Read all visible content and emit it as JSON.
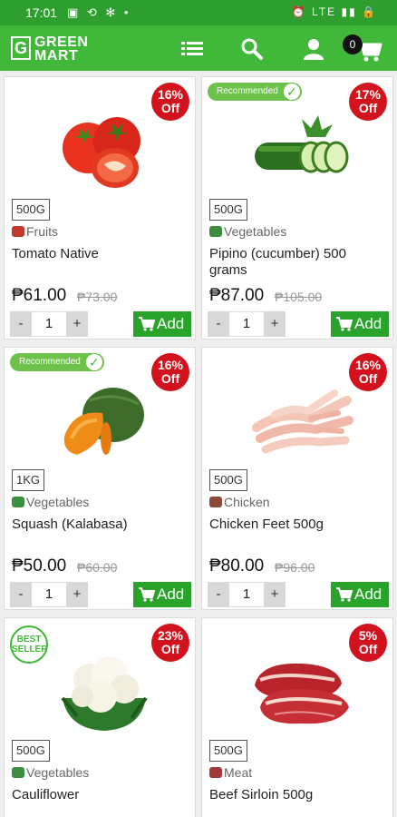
{
  "status_bar": {
    "time": "17:01",
    "left_icons": "▣ ⟲ ✻ •",
    "right_icons": "⏰ LTE ▮▮ 🔒"
  },
  "app": {
    "logo_line1": "GREEN",
    "logo_line2": "MART",
    "logo_letter": "G",
    "cart_count": "0",
    "accent": "#41b839"
  },
  "products": [
    {
      "name": "Tomato Native",
      "weight": "500G",
      "category": "Fruits",
      "cat_color": "#c0392b",
      "price": "₱61.00",
      "old_price": "₱73.00",
      "discount_pct": "16%",
      "discount_label": "Off",
      "qty": "1",
      "add_label": "Add",
      "badge": "",
      "image": "tomato"
    },
    {
      "name": "Pipino (cucumber) 500 grams",
      "weight": "500G",
      "category": "Vegetables",
      "cat_color": "#3e8e41",
      "price": "₱87.00",
      "old_price": "₱105.00",
      "discount_pct": "17%",
      "discount_label": "Off",
      "qty": "1",
      "add_label": "Add",
      "badge": "Recommended",
      "image": "cucumber"
    },
    {
      "name": "Squash (Kalabasa)",
      "weight": "1KG",
      "category": "Vegetables",
      "cat_color": "#3e8e41",
      "price": "₱50.00",
      "old_price": "₱60.00",
      "discount_pct": "16%",
      "discount_label": "Off",
      "qty": "1",
      "add_label": "Add",
      "badge": "Recommended",
      "image": "squash"
    },
    {
      "name": "Chicken Feet 500g",
      "weight": "500G",
      "category": "Chicken",
      "cat_color": "#8b4a3a",
      "price": "₱80.00",
      "old_price": "₱96.00",
      "discount_pct": "16%",
      "discount_label": "Off",
      "qty": "1",
      "add_label": "Add",
      "badge": "",
      "image": "chicken"
    },
    {
      "name": "Cauliflower",
      "weight": "500G",
      "category": "Vegetables",
      "cat_color": "#3e8e41",
      "price": "",
      "old_price": "",
      "discount_pct": "23%",
      "discount_label": "Off",
      "qty": "",
      "add_label": "",
      "badge": "BEST SELLER",
      "image": "cauliflower"
    },
    {
      "name": "Beef Sirloin 500g",
      "weight": "500G",
      "category": "Meat",
      "cat_color": "#a33a3a",
      "price": "",
      "old_price": "",
      "discount_pct": "5%",
      "discount_label": "Off",
      "qty": "",
      "add_label": "",
      "badge": "",
      "image": "beef"
    }
  ],
  "best_seller_line1": "BEST",
  "best_seller_line2": "SELLER"
}
